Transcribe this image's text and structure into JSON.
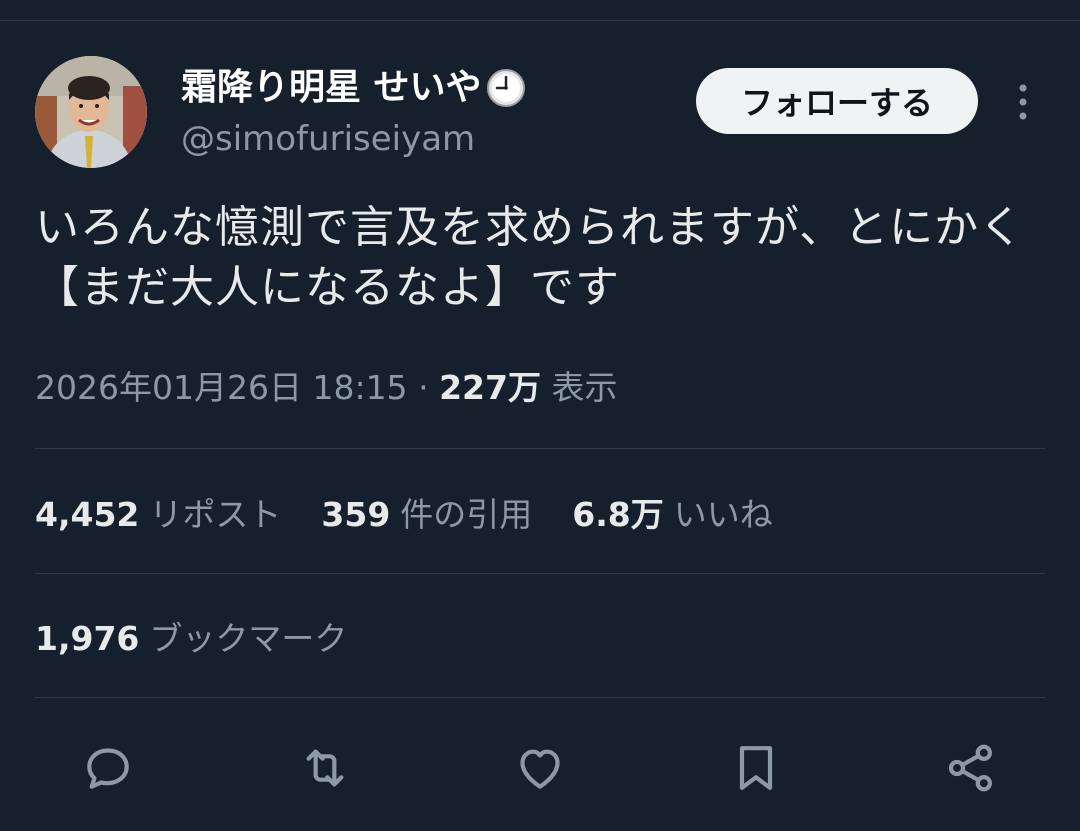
{
  "user": {
    "display_name": "霜降り明星 せいや",
    "handle": "@simofuriseiyam",
    "badge_icon": "clock-emoji-icon"
  },
  "follow_button_label": "フォローする",
  "tweet": {
    "text": "いろんな憶測で言及を求められますが、とにかく【まだ大人になるなよ】です",
    "timestamp": "2026年01月26日 18:15",
    "separator": "·",
    "views_count": "227万",
    "views_label": "表示"
  },
  "stats": {
    "reposts": {
      "count": "4,452",
      "label": "リポスト"
    },
    "quotes": {
      "count": "359",
      "label": "件の引用"
    },
    "likes": {
      "count": "6.8万",
      "label": "いいね"
    },
    "bookmarks": {
      "count": "1,976",
      "label": "ブックマーク"
    }
  },
  "actions": [
    "reply-icon",
    "retweet-icon",
    "like-icon",
    "bookmark-icon",
    "share-icon"
  ],
  "colors": {
    "background": "#16202c",
    "text_primary": "#e7e9ea",
    "text_secondary": "#8b98a5",
    "divider": "#2f3944",
    "follow_button_bg": "#eff3f4"
  }
}
